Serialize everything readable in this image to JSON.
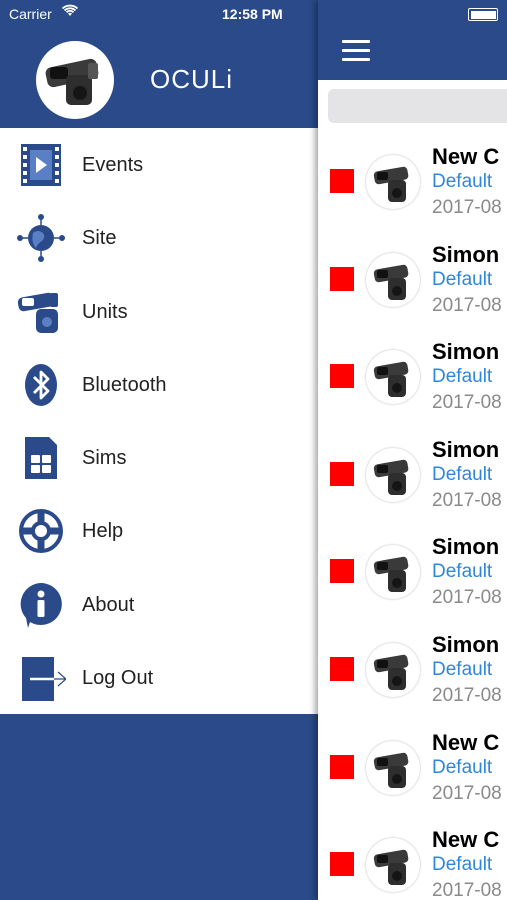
{
  "status_bar": {
    "carrier": "Carrier",
    "time": "12:58 PM"
  },
  "menu": {
    "app_title": "OCULi",
    "items": [
      {
        "label": "Events",
        "icon": "film-icon"
      },
      {
        "label": "Site",
        "icon": "globe-network-icon"
      },
      {
        "label": "Units",
        "icon": "camera-unit-icon"
      },
      {
        "label": "Bluetooth",
        "icon": "bluetooth-icon"
      },
      {
        "label": "Sims",
        "icon": "sim-card-icon"
      },
      {
        "label": "Help",
        "icon": "lifebuoy-icon"
      },
      {
        "label": "About",
        "icon": "info-icon"
      },
      {
        "label": "Log Out",
        "icon": "logout-icon"
      }
    ]
  },
  "events": [
    {
      "title": "New C",
      "subtitle": "Default",
      "date": "2017-08"
    },
    {
      "title": "Simon",
      "subtitle": "Default",
      "date": "2017-08"
    },
    {
      "title": "Simon",
      "subtitle": "Default",
      "date": "2017-08"
    },
    {
      "title": "Simon",
      "subtitle": "Default",
      "date": "2017-08"
    },
    {
      "title": "Simon",
      "subtitle": "Default",
      "date": "2017-08"
    },
    {
      "title": "Simon",
      "subtitle": "Default",
      "date": "2017-08"
    },
    {
      "title": "New C",
      "subtitle": "Default",
      "date": "2017-08"
    },
    {
      "title": "New C",
      "subtitle": "Default",
      "date": "2017-08"
    }
  ],
  "colors": {
    "brand": "#2a4a8a",
    "status_red": "#ff0000",
    "link_blue": "#2e86de"
  }
}
